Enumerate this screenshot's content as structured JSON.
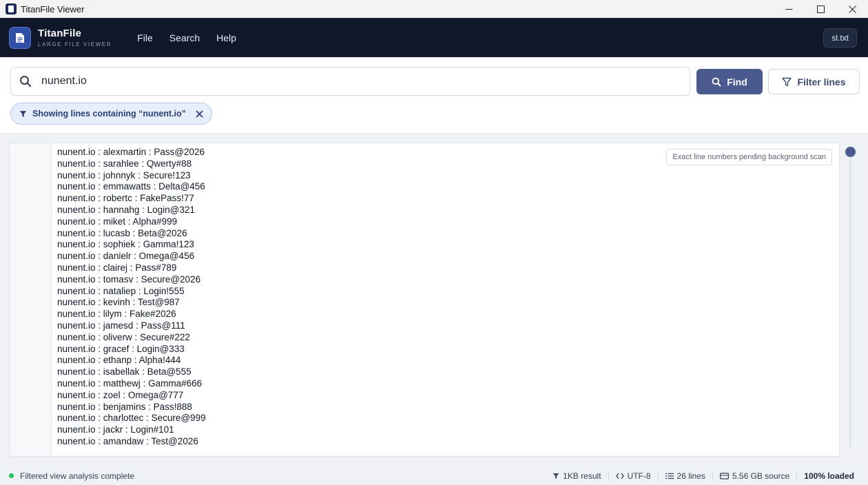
{
  "window": {
    "title": "TitanFile Viewer",
    "minimize_glyph": "—",
    "maximize_glyph": "☐",
    "close_glyph": "✕"
  },
  "header": {
    "brand_name": "TitanFile",
    "brand_sub": "LARGE FILE VIEWER",
    "menu": [
      "File",
      "Search",
      "Help"
    ],
    "file_chip": "sl.txt"
  },
  "search": {
    "value": "nunent.io",
    "find_label": "Find",
    "filter_label": "Filter lines",
    "chip_text": "Showing lines containing “nunent.io”"
  },
  "viewer": {
    "pending_note": "Exact line numbers pending background scan",
    "lines": [
      "nunent.io : alexmartin : Pass@2026",
      "nunent.io : sarahlee : Qwerty#88",
      "nunent.io : johnnyk : Secure!123",
      "nunent.io : emmawatts : Delta@456",
      "nunent.io : robertc : FakePass!77",
      "nunent.io : hannahg : Login@321",
      "nunent.io : miket : Alpha#999",
      "nunent.io : lucasb : Beta@2026",
      "nunent.io : sophiek : Gamma!123",
      "nunent.io : danielr : Omega@456",
      "nunent.io : clairej : Pass#789",
      "nunent.io : tomasv : Secure@2026",
      "nunent.io : nataliep : Login!555",
      "nunent.io : kevinh : Test@987",
      "nunent.io : lilym : Fake#2026",
      "nunent.io : jamesd : Pass@111",
      "nunent.io : oliverw : Secure#222",
      "nunent.io : gracef : Login@333",
      "nunent.io : ethanp : Alpha!444",
      "nunent.io : isabellak : Beta@555",
      "nunent.io : matthewj : Gamma#666",
      "nunent.io : zoel : Omega@777",
      "nunent.io : benjamins : Pass!888",
      "nunent.io : charlottec : Secure@999",
      "nunent.io : jackr : Login#101",
      "nunent.io : amandaw : Test@2026"
    ]
  },
  "status": {
    "message": "Filtered view analysis complete",
    "result_size": "1KB result",
    "encoding": "UTF-8",
    "line_count": "26 lines",
    "source_size": "5.56 GB source",
    "loaded": "100% loaded"
  },
  "colors": {
    "header_bg": "#0f1729",
    "accent": "#4a5a8f",
    "status_ok": "#22c55e"
  }
}
